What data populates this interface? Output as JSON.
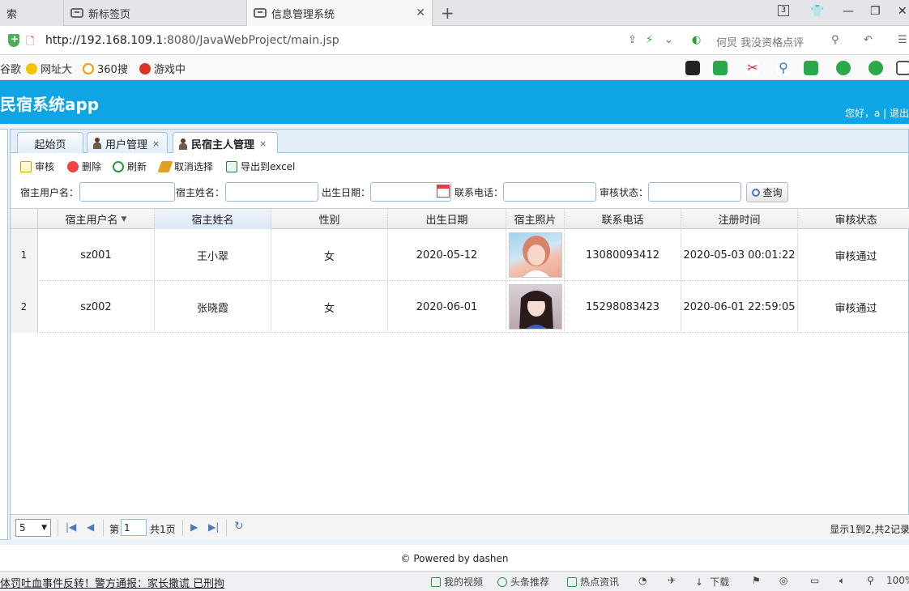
{
  "browser": {
    "tabs": [
      {
        "label": "索"
      },
      {
        "label": "新标签页"
      },
      {
        "label": "信息管理系统"
      }
    ],
    "url_host": "http://192.168.109.1",
    "url_rest": ":8080/JavaWebProject/main.jsp",
    "search_hint": "何炅 我没资格点评",
    "tab_count": "3",
    "bookmarks": [
      "谷歌",
      "网址大",
      "360搜",
      "游戏中"
    ]
  },
  "app": {
    "title": "民宿系统app",
    "greeting": "您好，a | 退出"
  },
  "tabs": [
    {
      "label": "起始页",
      "closable": false
    },
    {
      "label": "用户管理",
      "closable": true
    },
    {
      "label": "民宿主人管理",
      "closable": true
    }
  ],
  "toolbar": {
    "audit": "审核",
    "delete": "删除",
    "refresh": "刷新",
    "cancel_select": "取消选择",
    "export": "导出到excel"
  },
  "filters": {
    "username_label": "宿主用户名：",
    "name_label": "宿主姓名：",
    "birth_label": "出生日期：",
    "phone_label": "联系电话：",
    "status_label": "审核状态：",
    "query_button": "查询"
  },
  "table": {
    "columns": [
      "宿主用户名",
      "宿主姓名",
      "性别",
      "出生日期",
      "宿主照片",
      "联系电话",
      "注册时间",
      "审核状态"
    ],
    "rows": [
      {
        "num": "1",
        "username": "sz001",
        "name": "王小翠",
        "gender": "女",
        "birth": "2020-05-12",
        "phone": "13080093412",
        "reg_time": "2020-05-03 00:01:22",
        "status": "审核通过"
      },
      {
        "num": "2",
        "username": "sz002",
        "name": "张晓霞",
        "gender": "女",
        "birth": "2020-06-01",
        "phone": "15298083423",
        "reg_time": "2020-06-01 22:59:05",
        "status": "审核通过"
      }
    ]
  },
  "pager": {
    "page_size": "5",
    "page_prefix": "第",
    "page_value": "1",
    "page_total": "共1页",
    "info": "显示1到2,共2记录"
  },
  "footer": "© Powered by dashen",
  "statusbar": {
    "news": "体罚吐血事件反转！警方通报：家长撒谎 已刑拘",
    "items": [
      "我的视频",
      "头条推荐",
      "热点资讯",
      "下载",
      "100%"
    ]
  },
  "colors": {
    "header": "#0fa5e4",
    "panel_border": "#9cc3e6"
  }
}
